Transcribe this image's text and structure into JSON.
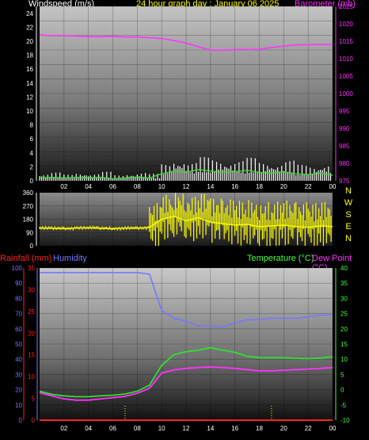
{
  "title": "24 hour graph day : January 06 2025",
  "colors": {
    "white": "#ffffff",
    "yellow": "#ffff00",
    "magenta": "#ff33ff",
    "green": "#33dd33",
    "blue": "#7777ff",
    "red": "#ff2222",
    "axis_green": "#44ff44"
  },
  "x_ticks": [
    "02",
    "04",
    "06",
    "08",
    "10",
    "12",
    "14",
    "16",
    "18",
    "20",
    "22",
    "00"
  ],
  "chart_data": [
    {
      "type": "line",
      "name": "wind",
      "left_label": "Windspeed (m/s)",
      "right_label": "Barometer (mb)",
      "left_ticks": [
        "0",
        "2",
        "4",
        "6",
        "8",
        "10",
        "12",
        "14",
        "16",
        "18",
        "20",
        "22",
        "24"
      ],
      "right_ticks": [
        "975",
        "980",
        "985",
        "990",
        "995",
        "1000",
        "1005",
        "1010",
        "1015",
        "1020",
        "1025"
      ],
      "ylim_left": [
        0,
        25
      ],
      "ylim_right": [
        975,
        1025
      ],
      "x": [
        0,
        1,
        2,
        3,
        4,
        5,
        6,
        7,
        8,
        9,
        10,
        11,
        12,
        13,
        14,
        15,
        16,
        17,
        18,
        19,
        20,
        21,
        22,
        23,
        24
      ],
      "series": [
        {
          "role": "barometer",
          "axis": "right",
          "values": [
            1016.8,
            1016.6,
            1016.6,
            1016.5,
            1016.3,
            1016.3,
            1016.4,
            1016.2,
            1016.2,
            1016.0,
            1015.8,
            1015.2,
            1014.5,
            1013.4,
            1012.5,
            1012.4,
            1012.6,
            1012.6,
            1012.7,
            1013.2,
            1013.6,
            1014.0,
            1014.0,
            1014.1,
            1014.0
          ]
        },
        {
          "role": "gust",
          "axis": "left",
          "values": [
            1.0,
            1.2,
            0.9,
            1.1,
            1.0,
            1.3,
            0.8,
            1.0,
            1.2,
            1.0,
            2.4,
            3.0,
            2.6,
            3.4,
            3.1,
            2.8,
            2.9,
            3.3,
            2.7,
            2.5,
            2.9,
            2.3,
            2.1,
            2.4,
            1.9
          ]
        },
        {
          "role": "average",
          "axis": "left",
          "values": [
            0.4,
            0.5,
            0.4,
            0.5,
            0.4,
            0.5,
            0.3,
            0.4,
            0.5,
            0.4,
            1.0,
            1.4,
            1.2,
            1.6,
            1.4,
            1.2,
            1.3,
            1.5,
            1.2,
            1.1,
            1.3,
            1.0,
            0.9,
            1.1,
            0.8
          ]
        }
      ]
    },
    {
      "type": "line",
      "name": "wind-direction",
      "left_ticks": [
        "0",
        "90",
        "180",
        "270",
        "360"
      ],
      "right_ticks": [
        "N",
        "W",
        "S",
        "E",
        "N"
      ],
      "ylim": [
        0,
        360
      ],
      "x": [
        0,
        1,
        2,
        3,
        4,
        5,
        6,
        7,
        8,
        9,
        10,
        11,
        12,
        13,
        14,
        15,
        16,
        17,
        18,
        19,
        20,
        21,
        22,
        23,
        24
      ],
      "series": [
        {
          "role": "direction",
          "values": [
            120,
            118,
            115,
            120,
            122,
            118,
            115,
            120,
            118,
            125,
            180,
            200,
            170,
            190,
            160,
            150,
            140,
            145,
            130,
            135,
            140,
            130,
            125,
            135,
            130
          ]
        }
      ]
    },
    {
      "type": "line",
      "name": "temperature-humidity",
      "left_label_1": "Rainfall (mm)",
      "left_label_2": "Humidity",
      "right_label_1": "Temperature (°C)",
      "right_label_2": "Dew Point (°C)",
      "rain_ticks": [
        "0",
        "5",
        "10",
        "15",
        "20",
        "25",
        "30",
        "35"
      ],
      "humidity_ticks": [
        "0",
        "10",
        "20",
        "30",
        "40",
        "50",
        "60",
        "70",
        "80",
        "90",
        "100"
      ],
      "temp_ticks": [
        "-10",
        "-5",
        "0",
        "5",
        "10",
        "15",
        "20",
        "25",
        "30",
        "35",
        "40"
      ],
      "ylim_rain": [
        0,
        35
      ],
      "ylim_humidity": [
        0,
        100
      ],
      "ylim_temp": [
        -10,
        40
      ],
      "x": [
        0,
        1,
        2,
        3,
        4,
        5,
        6,
        7,
        8,
        9,
        10,
        11,
        12,
        13,
        14,
        15,
        16,
        17,
        18,
        19,
        20,
        21,
        22,
        23,
        24
      ],
      "series": [
        {
          "role": "humidity",
          "axis": "humidity",
          "values": [
            97,
            97,
            97,
            97,
            97,
            97,
            97,
            97,
            97,
            96,
            72,
            67,
            65,
            62,
            62,
            61,
            64,
            66,
            66,
            67,
            67,
            67,
            68,
            69,
            69
          ]
        },
        {
          "role": "temperature",
          "axis": "temp",
          "values": [
            -0.5,
            -1.5,
            -2.0,
            -2.3,
            -2.3,
            -2.0,
            -1.8,
            -1.4,
            -0.5,
            1.5,
            8.0,
            11.5,
            12.5,
            13.0,
            13.8,
            13.0,
            12.3,
            11.0,
            10.5,
            10.5,
            10.5,
            10.3,
            10.2,
            10.4,
            10.8
          ]
        },
        {
          "role": "dewpoint",
          "axis": "temp",
          "values": [
            -1.0,
            -2.0,
            -3.0,
            -3.4,
            -3.4,
            -3.0,
            -2.6,
            -2.2,
            -1.2,
            0.5,
            5.5,
            6.5,
            7.0,
            7.3,
            7.5,
            7.3,
            7.0,
            6.6,
            6.2,
            6.2,
            6.4,
            6.6,
            6.8,
            7.0,
            7.3
          ]
        },
        {
          "role": "rainfall",
          "axis": "rain",
          "values": [
            0,
            0,
            0,
            0,
            0,
            0,
            0,
            0,
            0,
            0,
            0,
            0,
            0,
            0,
            0,
            0,
            0,
            0,
            0,
            0,
            0,
            0,
            0,
            0,
            0
          ]
        }
      ]
    }
  ]
}
